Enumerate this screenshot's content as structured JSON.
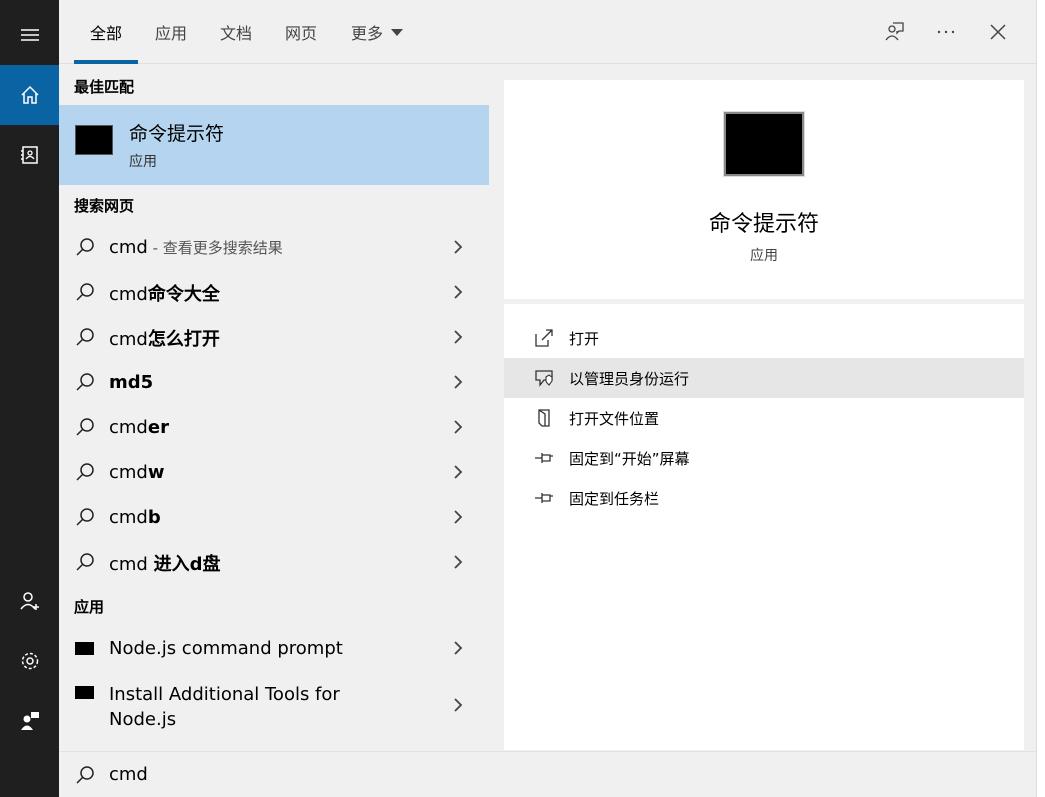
{
  "tabs": [
    {
      "label": "全部",
      "active": true
    },
    {
      "label": "应用"
    },
    {
      "label": "文档"
    },
    {
      "label": "网页"
    },
    {
      "label": "更多"
    }
  ],
  "sections": {
    "best_match": "最佳匹配",
    "search_web": "搜索网页",
    "apps": "应用"
  },
  "best_match": {
    "title": "命令提示符",
    "subtitle": "应用"
  },
  "web_results": [
    {
      "prefix": "cmd",
      "bold": "",
      "hint": " - 查看更多搜索结果"
    },
    {
      "prefix": "cmd",
      "bold": "命令大全",
      "hint": ""
    },
    {
      "prefix": "cmd",
      "bold": "怎么打开",
      "hint": ""
    },
    {
      "prefix": "",
      "bold": "md5",
      "hint": ""
    },
    {
      "prefix": "cmd",
      "bold": "er",
      "hint": ""
    },
    {
      "prefix": "cmd",
      "bold": "w",
      "hint": ""
    },
    {
      "prefix": "cmd",
      "bold": "b",
      "hint": ""
    },
    {
      "prefix": "cmd ",
      "bold": "进入d盘",
      "hint": ""
    }
  ],
  "app_results": [
    {
      "line1": "Node.js command prompt",
      "line2": ""
    },
    {
      "line1": "Install Additional Tools for",
      "line2": "Node.js"
    }
  ],
  "details": {
    "title": "命令提示符",
    "subtitle": "应用",
    "actions": [
      {
        "label": "打开",
        "icon": "open-icon"
      },
      {
        "label": "以管理员身份运行",
        "icon": "shield-icon"
      },
      {
        "label": "打开文件位置",
        "icon": "file-location-icon"
      },
      {
        "label": "固定到“开始”屏幕",
        "icon": "pin-icon"
      },
      {
        "label": "固定到任务栏",
        "icon": "pin-icon"
      }
    ]
  },
  "search": {
    "query": "cmd"
  },
  "colors": {
    "accent": "#0a64a4",
    "selected": "#b4d4ef",
    "rail": "#1f1f1f"
  }
}
